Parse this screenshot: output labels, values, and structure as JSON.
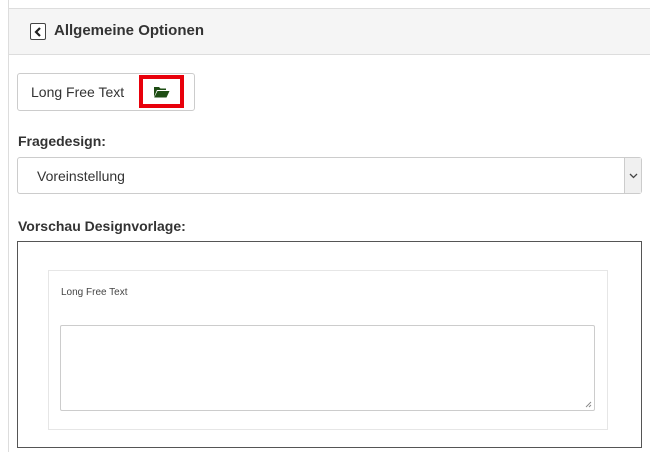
{
  "header": {
    "title": "Allgemeine Optionen",
    "back_icon": "chevron-left-icon"
  },
  "question_type": {
    "label": "Long Free Text",
    "icon": "folder-open-icon",
    "icon_color": "#1e4d14",
    "highlight_color": "#e8000b"
  },
  "design": {
    "label": "Fragedesign:",
    "selected": "Voreinstellung"
  },
  "preview": {
    "label": "Vorschau Designvorlage:",
    "question_text": "Long Free Text",
    "answer_value": ""
  }
}
